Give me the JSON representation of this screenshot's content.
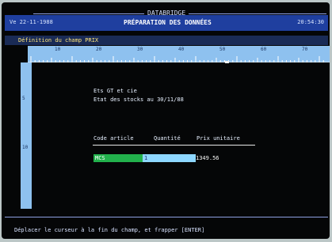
{
  "app_name": "DATABRIDGE",
  "title_bar": {
    "date": "Ve 22-11-1988",
    "title": "PRÉPARATION DES DONNÉES",
    "time": "20:54:30"
  },
  "field_definition": "Définition du champ PRIX",
  "ruler_numbers": [
    "10",
    "20",
    "30",
    "40",
    "50",
    "60",
    "70"
  ],
  "vertical_numbers": [
    "5",
    "10"
  ],
  "document": {
    "company": "Ets GT et cie",
    "report_title": "Etat des stocks au 30/11/88",
    "headers": [
      "Code article",
      "Quantité",
      "Prix unitaire"
    ],
    "row": {
      "code": "MCS",
      "quantity": "1",
      "price": "1349.56"
    }
  },
  "status": "Déplacer le curseur à la fin du champ, et frapper [ENTER]",
  "colors": {
    "title_bar": "#1f3f9f",
    "ruler": "#8ec1ef",
    "highlight_green": "#22b14c",
    "highlight_blue": "#8dd7ff"
  }
}
